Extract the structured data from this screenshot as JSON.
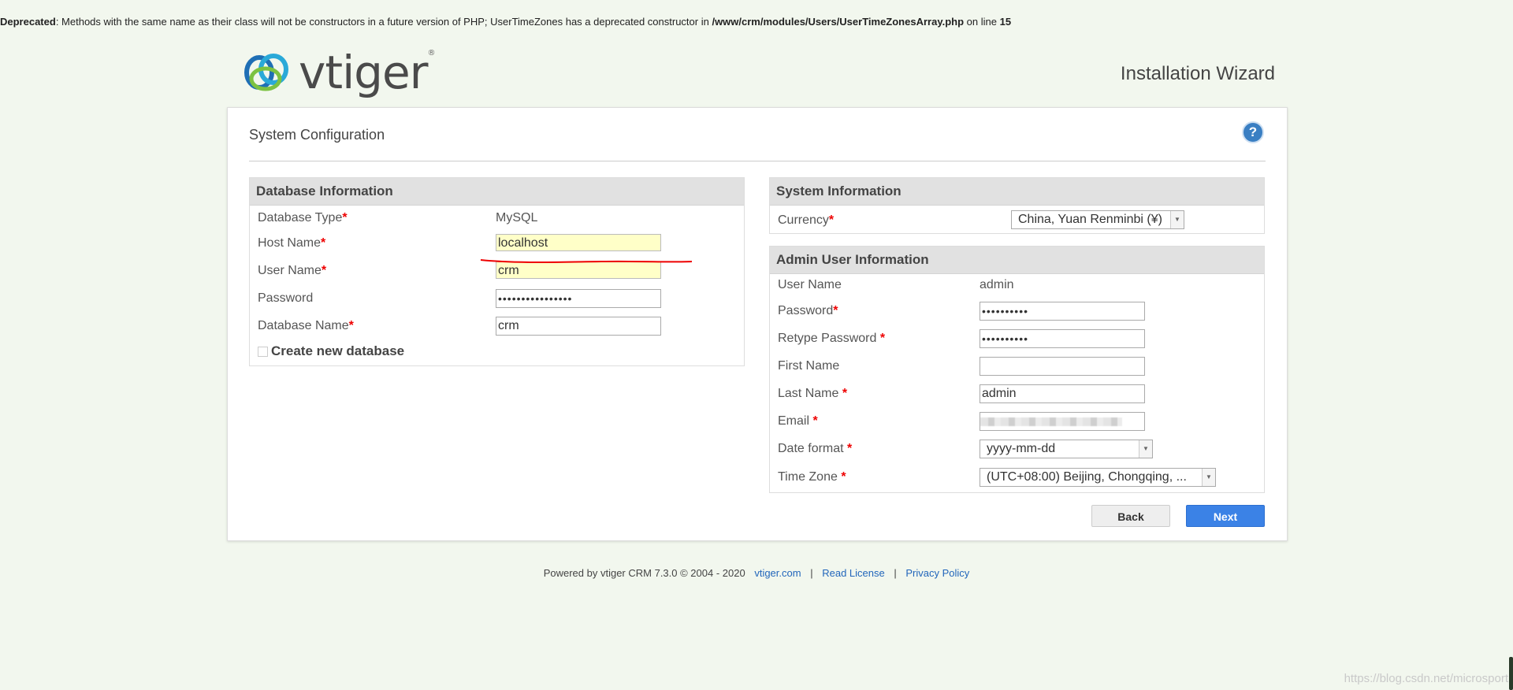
{
  "deprecated": {
    "label": "Deprecated",
    "message": "Methods with the same name as their class will not be constructors in a future version of PHP; UserTimeZones has a deprecated constructor in",
    "path": "/www/crm/modules/Users/UserTimeZonesArray.php",
    "on_line": "on line",
    "line": "15"
  },
  "header": {
    "logo_text": "vtiger",
    "title": "Installation Wizard"
  },
  "panel": {
    "title": "System Configuration"
  },
  "database": {
    "heading": "Database Information",
    "type_label": "Database Type",
    "type_value": "MySQL",
    "host_label": "Host Name",
    "host_value": "localhost",
    "user_label": "User Name",
    "user_value": "crm",
    "password_label": "Password",
    "password_value": "••••••••••••••••",
    "dbname_label": "Database Name",
    "dbname_value": "crm",
    "create_label": "Create new database"
  },
  "system": {
    "heading": "System Information",
    "currency_label": "Currency",
    "currency_value": "China, Yuan Renminbi (¥)"
  },
  "admin": {
    "heading": "Admin User Information",
    "username_label": "User Name",
    "username_value": "admin",
    "password_label": "Password",
    "password_value": "••••••••••",
    "retype_label": "Retype Password",
    "retype_value": "••••••••••",
    "firstname_label": "First Name",
    "firstname_value": "",
    "lastname_label": "Last Name",
    "lastname_value": "admin",
    "email_label": "Email",
    "dateformat_label": "Date format",
    "dateformat_value": "yyyy-mm-dd",
    "timezone_label": "Time Zone",
    "timezone_value": "(UTC+08:00) Beijing, Chongqing, ..."
  },
  "buttons": {
    "back": "Back",
    "next": "Next"
  },
  "footer": {
    "powered": "Powered by vtiger CRM 7.3.0  © 2004 - 2020",
    "site_link": "vtiger.com",
    "license_link": "Read License",
    "privacy_link": "Privacy Policy",
    "separator": "|"
  },
  "watermark": "https://blog.csdn.net/microsport",
  "colors": {
    "background": "#f2f7ee",
    "accent": "#3b82e6",
    "required": "#e00000",
    "annotation": "#e00000"
  }
}
